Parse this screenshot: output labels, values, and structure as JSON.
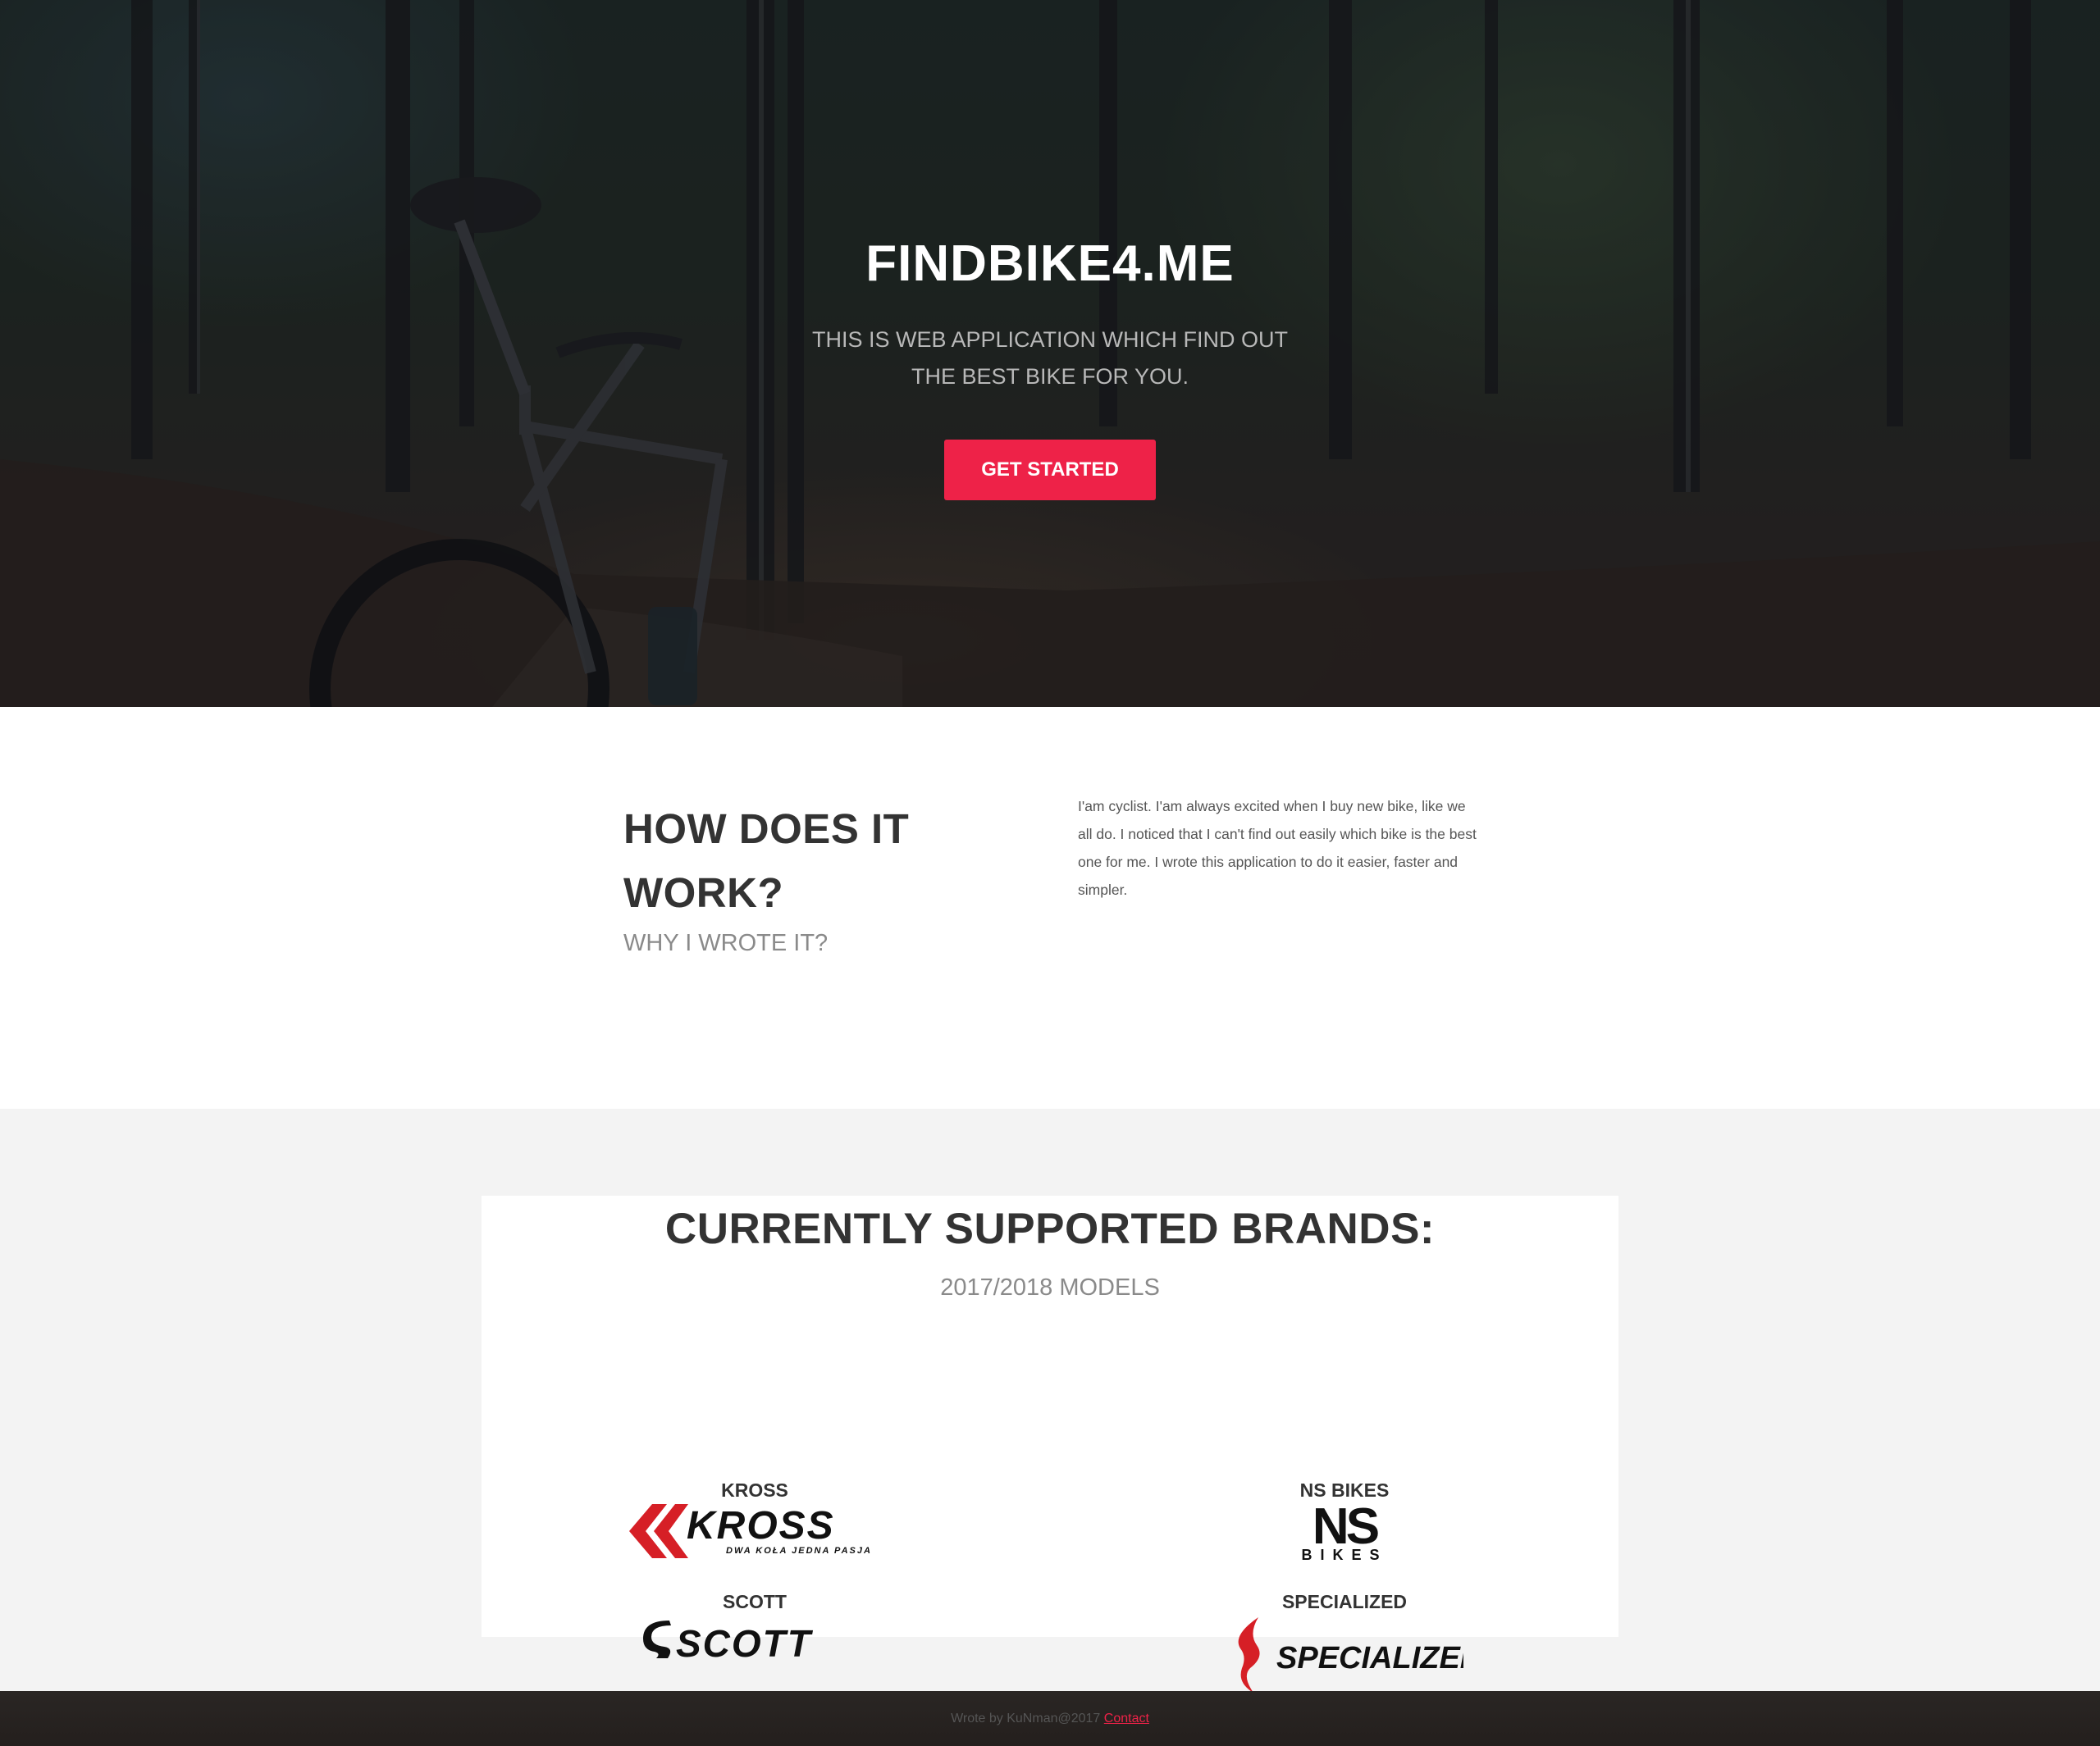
{
  "hero": {
    "title": "FINDBIKE4.ME",
    "subtitle": "THIS IS WEB APPLICATION WHICH FIND OUT THE BEST BIKE FOR YOU.",
    "cta_label": "GET STARTED",
    "background_icon": "forest-bike-photo"
  },
  "how": {
    "title": "HOW DOES IT WORK?",
    "subtitle": "WHY I WROTE IT?",
    "body": "I'am cyclist. I'am always excited when I buy new bike, like we all do. I noticed that I can't find out easily which bike is the best one for me. I wrote this application to do it easier, faster and simpler."
  },
  "brands": {
    "title": "CURRENTLY SUPPORTED BRANDS:",
    "subtitle": "2017/2018 MODELS",
    "items": [
      {
        "name": "KROSS",
        "logo": "kross-logo",
        "logo_text": "KROSS",
        "logo_tagline": "DWA KOŁA JEDNA PASJA"
      },
      {
        "name": "NS BIKES",
        "logo": "ns-bikes-logo",
        "logo_text": "NS",
        "logo_tagline": "BIKES"
      },
      {
        "name": "SCOTT",
        "logo": "scott-logo",
        "logo_text": "SCOTT"
      },
      {
        "name": "SPECIALIZED",
        "logo": "specialized-logo",
        "logo_text": "SPECIALIZED"
      }
    ]
  },
  "footer": {
    "text": "Wrote by KuNman@2017",
    "link": "Contact"
  },
  "colors": {
    "accent": "#ee2248",
    "heading": "#333333",
    "muted": "#8a8a8a",
    "section_bg": "#f3f3f3"
  }
}
